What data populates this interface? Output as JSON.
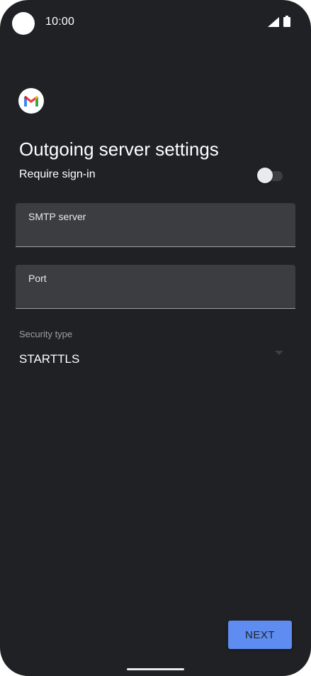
{
  "status_bar": {
    "time": "10:00"
  },
  "icons": {
    "camera": "camera-cutout-icon",
    "signal": "cellular-signal-icon",
    "battery": "battery-icon",
    "app_logo": "gmail-icon",
    "dropdown": "dropdown-arrow-icon"
  },
  "page": {
    "title": "Outgoing server settings"
  },
  "require_signin": {
    "label": "Require sign-in",
    "enabled": false
  },
  "smtp_server": {
    "label": "SMTP server",
    "value": ""
  },
  "port": {
    "label": "Port",
    "value": ""
  },
  "security_type": {
    "label": "Security type",
    "selected": "STARTTLS"
  },
  "actions": {
    "next_label": "NEXT"
  },
  "colors": {
    "background": "#202124",
    "field_fill": "#3c3d41",
    "accent": "#5e8cf0",
    "text_primary": "#ffffff",
    "text_secondary": "#9aa0a6"
  }
}
